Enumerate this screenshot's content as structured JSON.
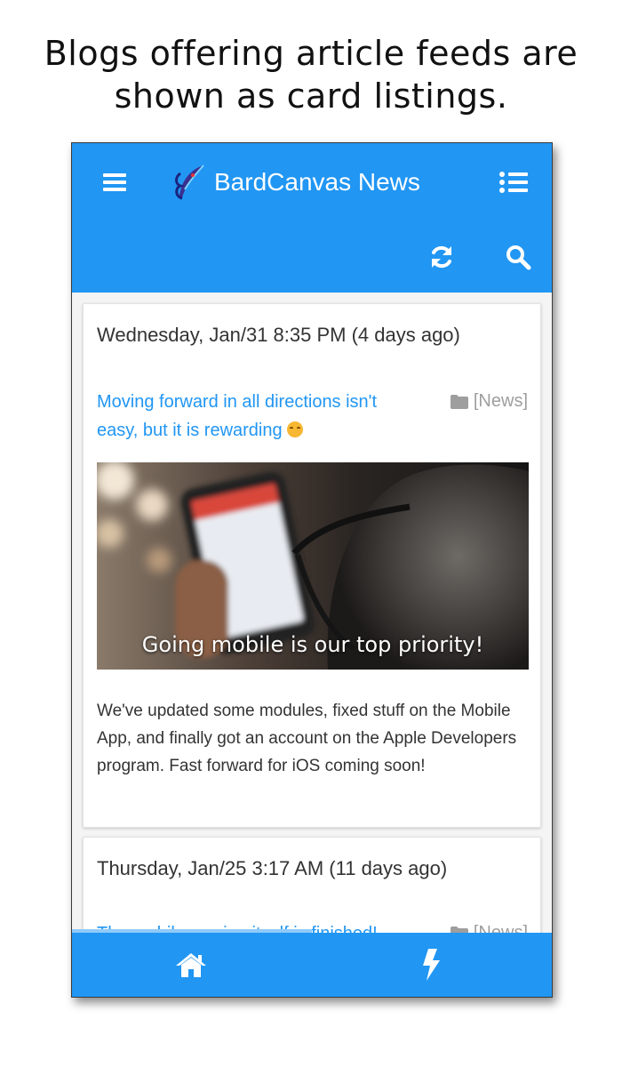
{
  "caption": {
    "line1": "Blogs offering article feeds are",
    "line2": "shown as card listings."
  },
  "header": {
    "title": "BardCanvas News",
    "icons": [
      "menu-icon",
      "logo-quill-icon",
      "list-icon",
      "refresh-icon",
      "search-icon"
    ]
  },
  "posts": [
    {
      "date": "Wednesday, Jan/31 8:35 PM (4 days ago)",
      "title": "Moving forward in all directions isn't easy, but it is rewarding",
      "category": "[News]",
      "image_caption": "Going mobile is our top priority!",
      "excerpt": "We've updated some modules, fixed stuff on the Mobile App, and finally got an account on the Apple Developers program. Fast forward for iOS coming soon!"
    },
    {
      "date": "Thursday, Jan/25 3:17 AM (11 days ago)",
      "title": "The mobile version itself is finished! Alpha",
      "category": "[News]"
    }
  ],
  "bottom_nav": {
    "icons": [
      "home-icon",
      "bolt-icon"
    ]
  },
  "colors": {
    "primary": "#2196f3",
    "link": "#2196f3",
    "muted": "#9e9e9e"
  }
}
